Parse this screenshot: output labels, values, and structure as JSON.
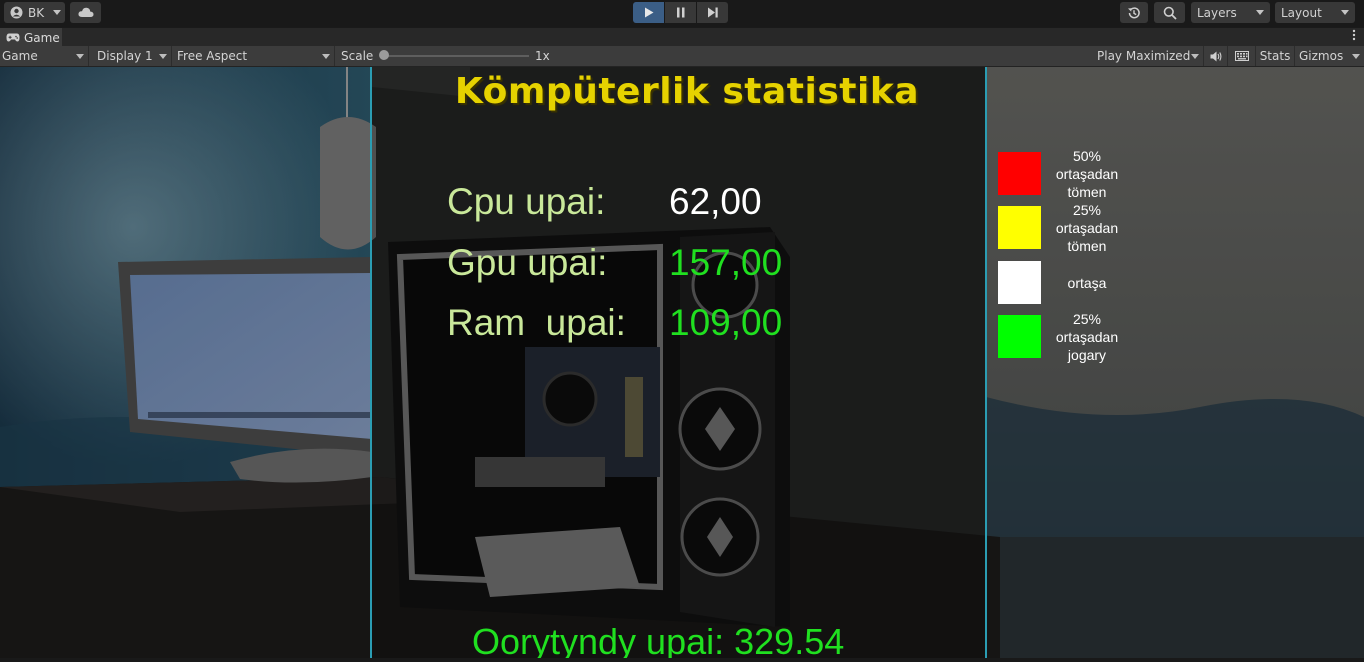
{
  "toolbar": {
    "account_label": "BK",
    "layers_label": "Layers",
    "layout_label": "Layout"
  },
  "tab": {
    "label": "Game"
  },
  "game_toolbar": {
    "mode_label": "Game",
    "display_label": "Display 1",
    "aspect_label": "Free Aspect",
    "scale_label": "Scale",
    "scale_value": "1x",
    "scale_fraction": 0.0,
    "play_maximized_label": "Play Maximized",
    "stats_label": "Stats",
    "gizmos_label": "Gizmos"
  },
  "overlay": {
    "title": "Kömpüterlik statistika",
    "stats": [
      {
        "label": "Cpu upai:",
        "value": "62,00",
        "color": "#ffffff"
      },
      {
        "label": "Gpu upai:",
        "value": "157,00",
        "color": "#20e020"
      },
      {
        "label": "Ram  upai:",
        "value": "109,00",
        "color": "#20e020"
      }
    ],
    "total": "Oorytyndy upai: 329.54",
    "legend": [
      {
        "color": "#ff0000",
        "lines": [
          "50%",
          "ortaşadan",
          "tömen"
        ]
      },
      {
        "color": "#ffff00",
        "lines": [
          "25%",
          "ortaşadan",
          "tömen"
        ]
      },
      {
        "color": "#ffffff",
        "lines": [
          "ortaşa"
        ]
      },
      {
        "color": "#00ff00",
        "lines": [
          "25%",
          "ortaşadan",
          "jogary"
        ]
      }
    ]
  },
  "icons": {
    "account": "account-icon",
    "cloud": "cloud-icon",
    "play": "play-icon",
    "pause": "pause-icon",
    "step": "step-icon",
    "history": "history-icon",
    "search": "search-icon",
    "gamepad": "gamepad-icon",
    "more": "more-vert-icon",
    "audio": "audio-icon",
    "keyboard": "keyboard-icon"
  }
}
